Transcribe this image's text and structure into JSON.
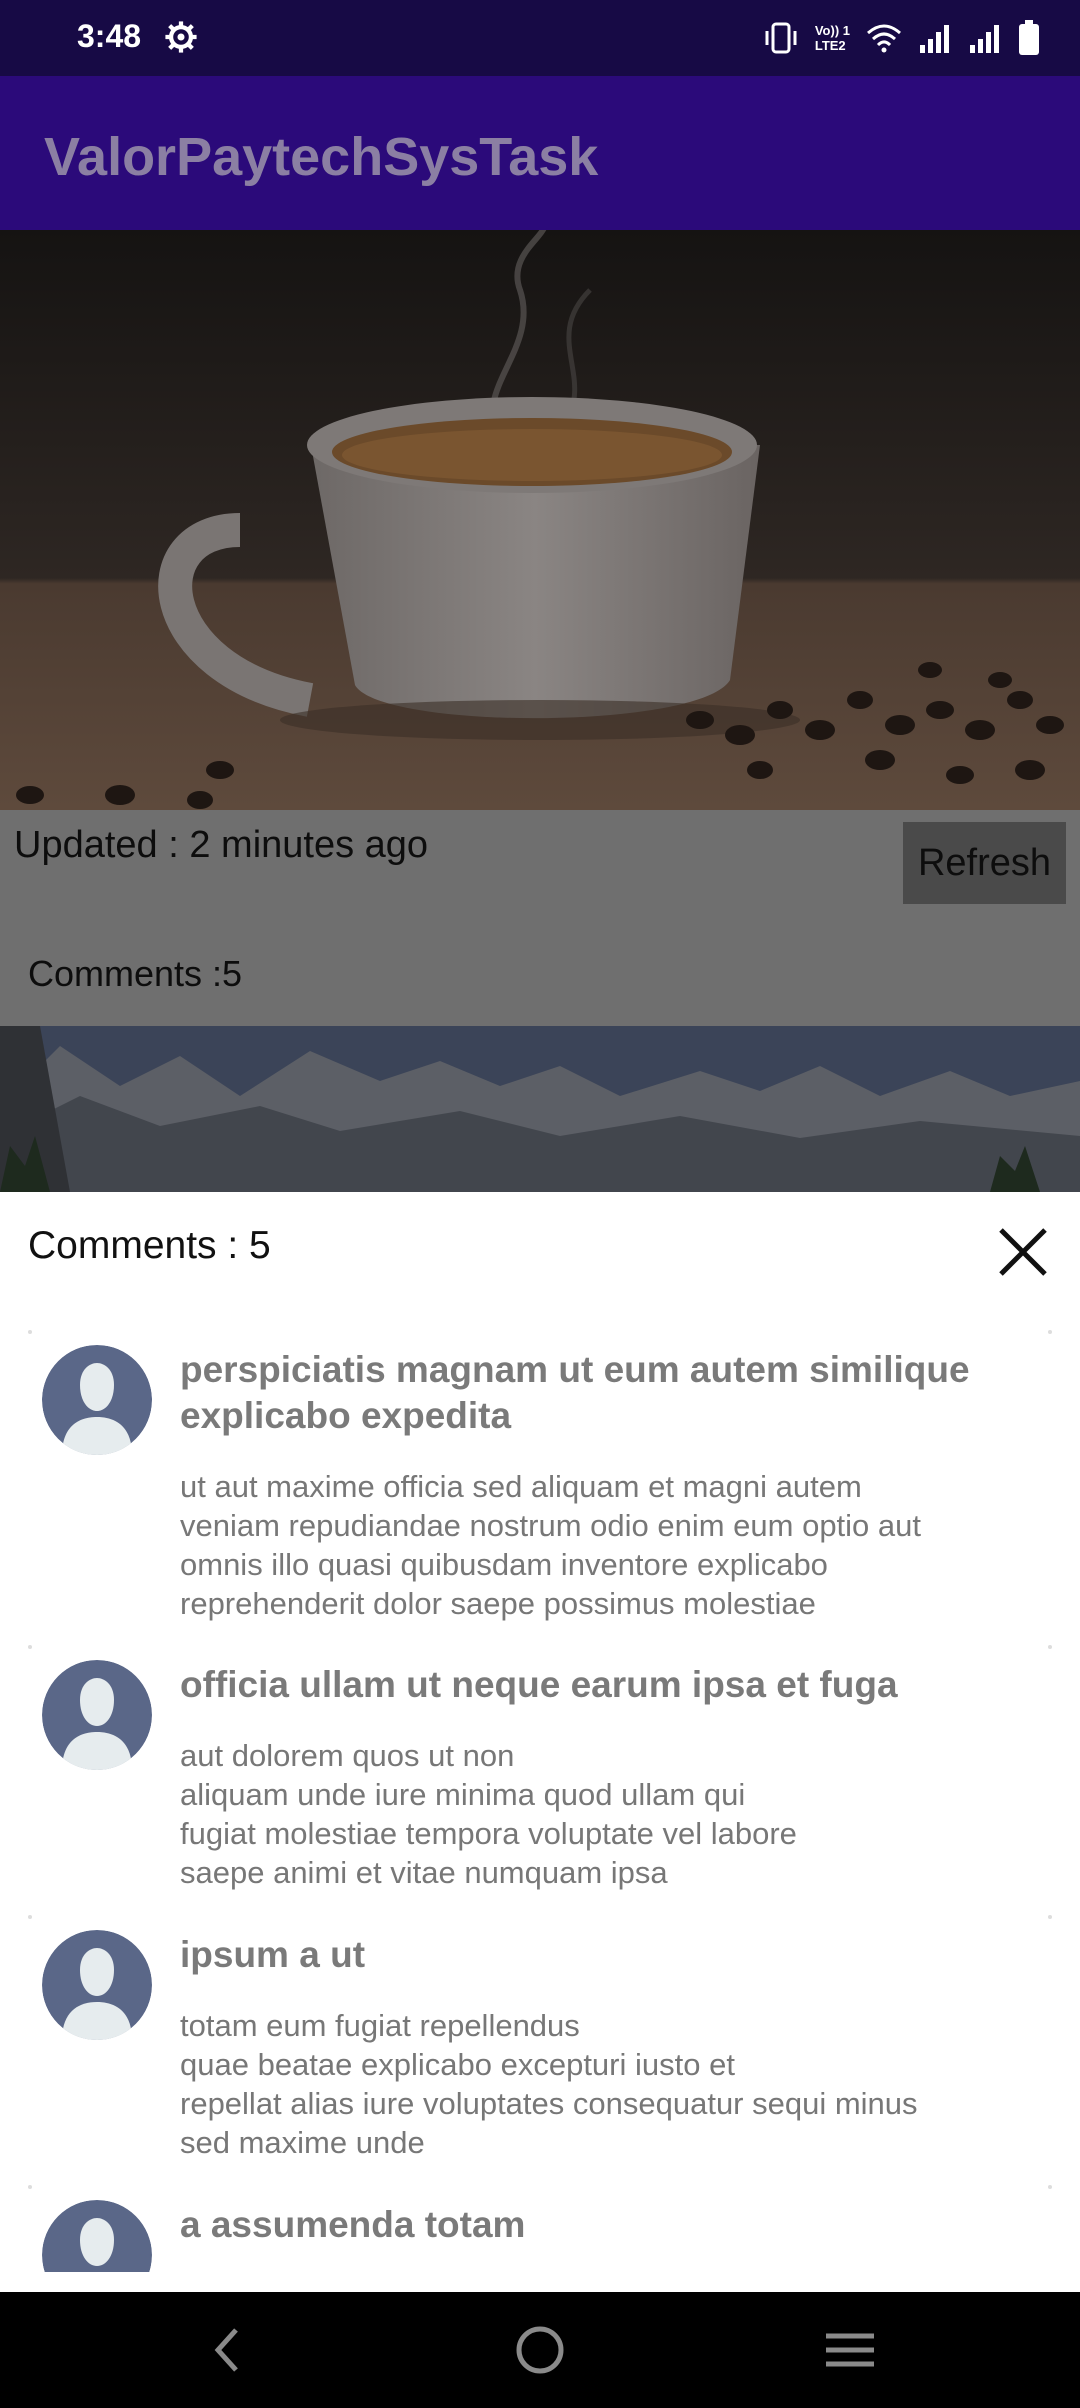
{
  "status_bar": {
    "time": "3:48",
    "lte_label": "LTE2",
    "volte_label": "Vo)) 1"
  },
  "app_bar": {
    "title": "ValorPaytechSysTask"
  },
  "feed": {
    "post": {
      "updated": "Updated : 2 minutes ago",
      "refresh_label": "Refresh",
      "comments_label": "Comments :5"
    }
  },
  "comments_sheet": {
    "title": "Comments : 5",
    "comments": [
      {
        "title": "perspiciatis magnam ut eum autem similique explicabo expedita",
        "body": "ut aut maxime officia sed aliquam et magni autem\nveniam repudiandae nostrum odio enim eum optio aut\nomnis illo quasi quibusdam inventore explicabo\nreprehenderit dolor saepe possimus molestiae"
      },
      {
        "title": "officia ullam ut neque earum ipsa et fuga",
        "body": "aut dolorem quos ut non\naliquam unde iure minima quod ullam qui\nfugiat molestiae tempora voluptate vel labore\nsaepe animi et vitae numquam ipsa"
      },
      {
        "title": "ipsum a ut",
        "body": "totam eum fugiat repellendus\nquae beatae explicabo excepturi iusto et\nrepellat alias iure voluptates consequatur sequi minus\nsed maxime unde"
      },
      {
        "title": "a assumenda totam",
        "body": ""
      }
    ]
  },
  "icons": {
    "gear": "gear-icon",
    "vibrate": "vibrate-icon",
    "wifi": "wifi-icon",
    "signal": "signal-icon",
    "battery": "battery-icon",
    "close": "close-icon",
    "back": "back-icon",
    "home": "home-icon",
    "recents": "recents-icon"
  }
}
